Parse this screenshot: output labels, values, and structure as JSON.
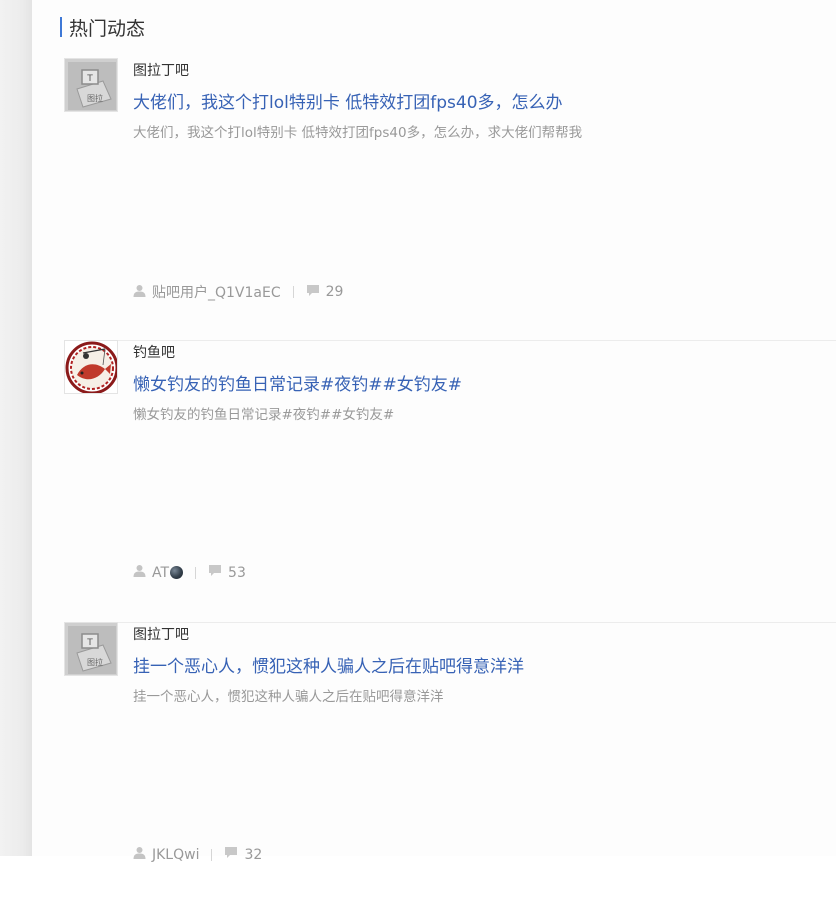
{
  "section": {
    "title": "热门动态"
  },
  "posts": [
    {
      "forum": "图拉丁吧",
      "avatar_icon": "tuladin-forum-logo",
      "title": "大佬们，我这个打lol特别卡 低特效打团fps40多，怎么办",
      "abstract": "大佬们，我这个打lol特别卡 低特效打团fps40多，怎么办，求大佬们帮帮我",
      "author": "贴吧用户_Q1V1aEC",
      "replies": "29"
    },
    {
      "forum": "钓鱼吧",
      "avatar_icon": "fishing-forum-logo",
      "title": "懒女钓友的钓鱼日常记录#夜钓##女钓友#",
      "abstract": "懒女钓友的钓鱼日常记录#夜钓##女钓友#",
      "author": "AT",
      "author_emoji": "dark-circle-emoji",
      "replies": "53"
    },
    {
      "forum": "图拉丁吧",
      "avatar_icon": "tuladin-forum-logo",
      "title": "挂一个恶心人，惯犯这种人骗人之后在贴吧得意洋洋",
      "abstract": "挂一个恶心人，惯犯这种人骗人之后在贴吧得意洋洋",
      "author": "JKLQwi",
      "replies": "32"
    }
  ],
  "colors": {
    "accent": "#3e78d6",
    "title_link": "#3762b5",
    "muted": "#999999"
  }
}
